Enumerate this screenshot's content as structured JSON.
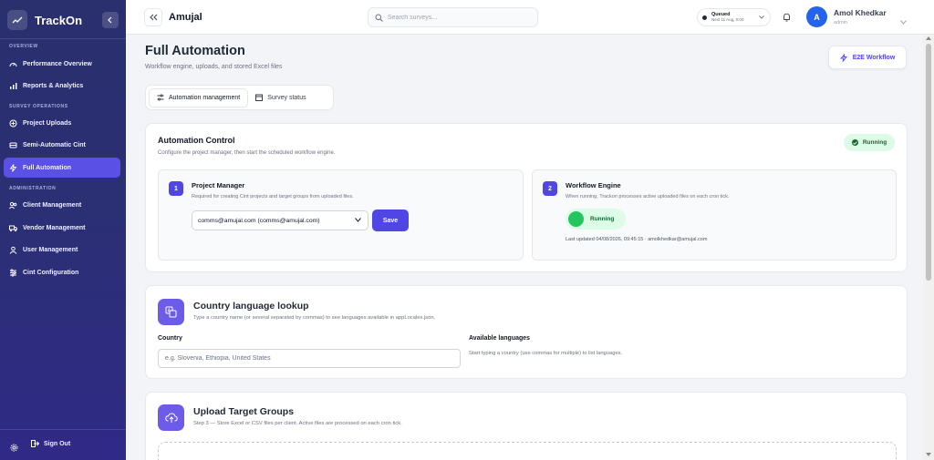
{
  "app": {
    "name": "TrackOn"
  },
  "sidebar": {
    "sections": [
      {
        "label": "OVERVIEW"
      },
      {
        "label": "SURVEY OPERATIONS"
      },
      {
        "label": "ADMINISTRATION"
      }
    ],
    "items": [
      {
        "label": "Performance Overview",
        "icon": "gauge-icon"
      },
      {
        "label": "Reports & Analytics",
        "icon": "bar-chart-icon"
      },
      {
        "label": "Project Uploads",
        "icon": "upload-icon"
      },
      {
        "label": "Semi-Automatic Cint",
        "icon": "bus-icon"
      },
      {
        "label": "Full Automation",
        "icon": "lightning-icon",
        "active": true
      },
      {
        "label": "Client Management",
        "icon": "users-icon"
      },
      {
        "label": "Vendor Management",
        "icon": "truck-icon"
      },
      {
        "label": "User Management",
        "icon": "user-icon"
      },
      {
        "label": "Cint Configuration",
        "icon": "sliders-icon"
      }
    ],
    "sign_out": "Sign Out"
  },
  "header": {
    "org": "Amujal",
    "search_placeholder": "Search surveys...",
    "queue": {
      "title": "Queued",
      "next": "Next 11 Aug, 0:00"
    },
    "user": {
      "initial": "A",
      "name": "Amol Khedkar",
      "role": "admin"
    }
  },
  "page": {
    "title": "Full Automation",
    "subtitle": "Workflow engine, uploads, and stored Excel files",
    "e2e_button": "E2E Workflow",
    "tabs": [
      {
        "label": "Automation management",
        "active": true
      },
      {
        "label": "Survey status",
        "active": false
      }
    ]
  },
  "automation_control": {
    "title": "Automation Control",
    "subtitle": "Configure the project manager, then start the scheduled workflow engine.",
    "status": "Running",
    "project_manager": {
      "step": "1",
      "title": "Project Manager",
      "desc": "Required for creating Cint projects and target groups from uploaded files.",
      "selected": "comms@amujal.com (comms@amujal.com)",
      "save": "Save"
    },
    "workflow_engine": {
      "step": "2",
      "title": "Workflow Engine",
      "desc": "When running, Trackon processes active uploaded files on each cron tick.",
      "toggle_label": "Running",
      "updated": "Last updated 04/08/2026, 09:45:15 · amolkhedkar@amujal.com"
    }
  },
  "country_lookup": {
    "title": "Country language lookup",
    "subtitle": "Type a country name (or several separated by commas) to see languages available in appLocales.json.",
    "country_label": "Country",
    "country_placeholder": "e.g. Slovenia, Ethiopia, United States",
    "languages_label": "Available languages",
    "languages_hint": "Start typing a country (use commas for multiple) to list languages."
  },
  "upload": {
    "title": "Upload Target Groups",
    "subtitle": "Step 3 — Store Excel or CSV files per client. Active files are processed on each cron tick."
  },
  "colors": {
    "accent": "#4f46e5",
    "sidebar": "#2b2f74",
    "success": "#22c55e"
  }
}
